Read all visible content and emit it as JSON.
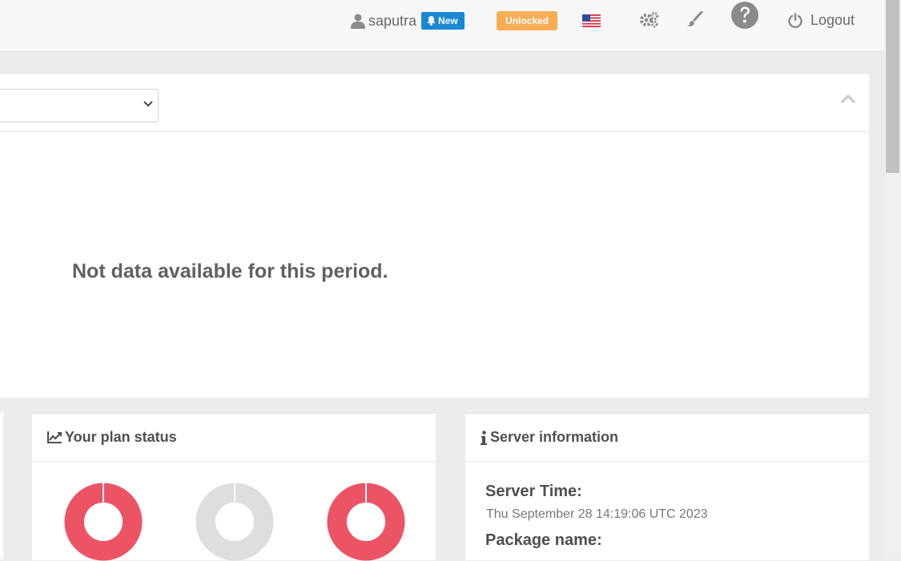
{
  "header": {
    "username": "saputra",
    "new_badge": "New",
    "unlocked_badge": "Unlocked",
    "logout_label": "Logout",
    "icons": [
      "user-icon",
      "bell-icon",
      "us-flag-icon",
      "cogs-icon",
      "brush-icon",
      "help-icon",
      "power-icon"
    ]
  },
  "main": {
    "empty_message": "Not data available for this period."
  },
  "plan_status": {
    "title": "Your plan status",
    "donuts": [
      {
        "color": "#ec5466",
        "fill": 0.995
      },
      {
        "color": "#dedede",
        "fill": 0.995
      },
      {
        "color": "#ec5466",
        "fill": 0.995
      }
    ]
  },
  "server_info": {
    "title": "Server information",
    "server_time_label": "Server Time:",
    "server_time_value": "Thu September 28 14:19:06 UTC 2023",
    "package_name_label": "Package name:"
  },
  "colors": {
    "badge_new": "#1a88d3",
    "badge_unlocked": "#f6ad55",
    "donut_red": "#ec5466",
    "donut_grey": "#dedede"
  }
}
